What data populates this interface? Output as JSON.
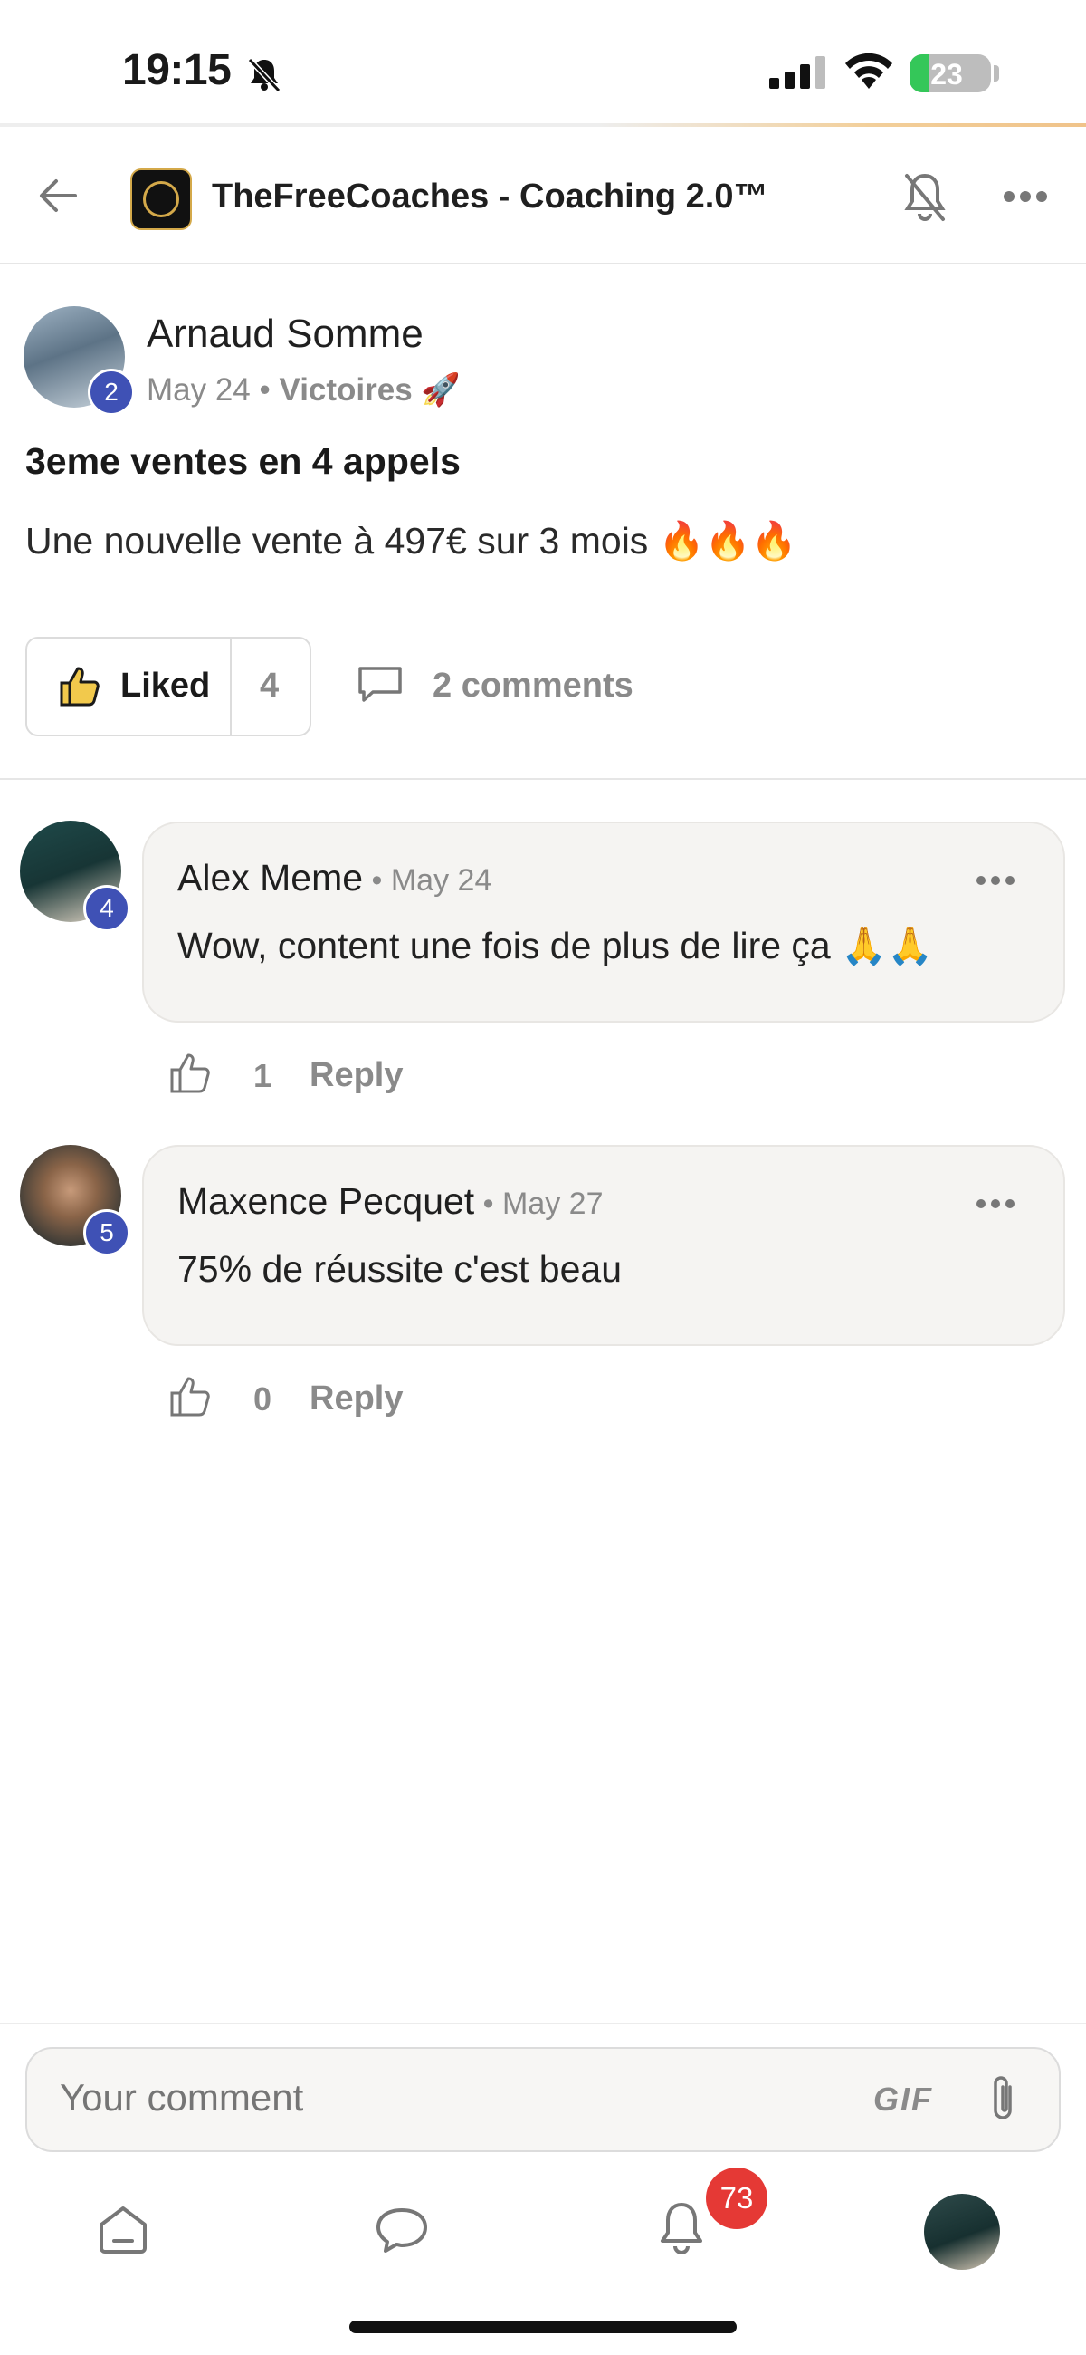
{
  "status_bar": {
    "time": "19:15",
    "battery": "23"
  },
  "header": {
    "title": "TheFreeCoaches - Coaching 2.0™"
  },
  "post": {
    "author": "Arnaud Somme",
    "level": "2",
    "date": "May 24",
    "separator": " • ",
    "category": "Victoires 🚀",
    "title": "3eme ventes en 4 appels",
    "body": "Une nouvelle vente à 497€ sur 3 mois 🔥🔥🔥",
    "like_label": "Liked",
    "like_count": "4",
    "comments_label": "2 comments"
  },
  "comments": [
    {
      "author": "Alex Meme",
      "level": "4",
      "date": " • May 24",
      "text": "Wow, content une fois de plus de lire ça 🙏🙏",
      "likes": "1",
      "reply_label": "Reply"
    },
    {
      "author": "Maxence Pecquet",
      "level": "5",
      "date": " • May 27",
      "text": "75% de réussite c'est beau",
      "likes": "0",
      "reply_label": "Reply"
    }
  ],
  "composer": {
    "placeholder": "Your comment",
    "gif_label": "GIF"
  },
  "bottom_nav": {
    "notification_count": "73"
  },
  "colors": {
    "level_badge": "#3f51b5",
    "notification_badge": "#e53935",
    "battery_fill": "#34c759"
  }
}
